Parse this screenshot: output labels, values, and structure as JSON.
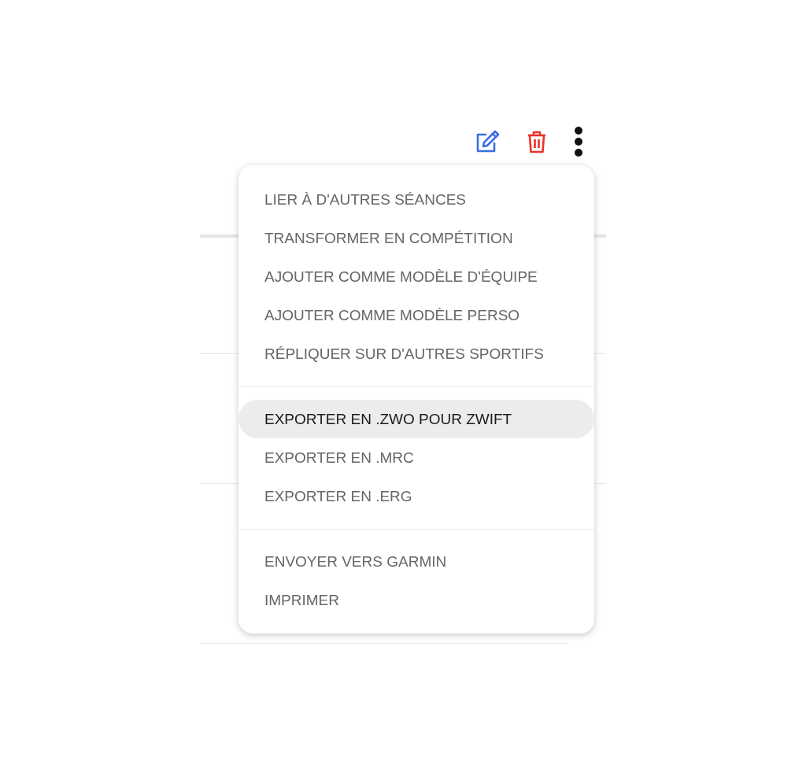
{
  "toolbar": {
    "buttons": [
      {
        "kind": "edit"
      },
      {
        "kind": "delete"
      },
      {
        "kind": "more"
      }
    ]
  },
  "menu": {
    "groups": [
      {
        "items": [
          {
            "label": "LIER À D'AUTRES SÉANCES",
            "selected": false
          },
          {
            "label": "TRANSFORMER EN COMPÉTITION",
            "selected": false
          },
          {
            "label": "AJOUTER COMME MODÈLE D'ÉQUIPE",
            "selected": false
          },
          {
            "label": "AJOUTER COMME MODÈLE PERSO",
            "selected": false
          },
          {
            "label": "RÉPLIQUER SUR D'AUTRES SPORTIFS",
            "selected": false
          }
        ]
      },
      {
        "items": [
          {
            "label": "EXPORTER EN .ZWO POUR ZWIFT",
            "selected": true
          },
          {
            "label": "EXPORTER EN .MRC",
            "selected": false
          },
          {
            "label": "EXPORTER EN .ERG",
            "selected": false
          }
        ]
      },
      {
        "items": [
          {
            "label": "ENVOYER VERS GARMIN",
            "selected": false
          },
          {
            "label": "IMPRIMER",
            "selected": false
          }
        ]
      }
    ]
  }
}
